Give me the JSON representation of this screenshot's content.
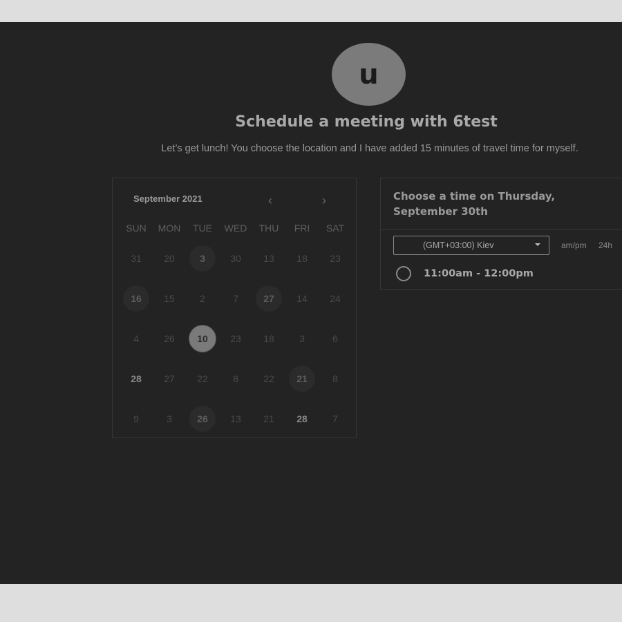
{
  "avatar": {
    "initial": "u"
  },
  "header": {
    "title": "Schedule a meeting with 6test",
    "subtitle": "Let’s get lunch! You choose the location and I have added 15 minutes of travel time for myself."
  },
  "calendar": {
    "month_label": "September 2021",
    "prev_icon": "‹",
    "next_icon": "›",
    "weekdays": [
      "SUN",
      "MON",
      "TUE",
      "WED",
      "THU",
      "FRI",
      "SAT"
    ],
    "weeks": [
      [
        {
          "d": "31"
        },
        {
          "d": "20"
        },
        {
          "d": "3",
          "avail": true
        },
        {
          "d": "30"
        },
        {
          "d": "13"
        },
        {
          "d": "18"
        },
        {
          "d": "23"
        }
      ],
      [
        {
          "d": "16",
          "avail": true
        },
        {
          "d": "15"
        },
        {
          "d": "2"
        },
        {
          "d": "7"
        },
        {
          "d": "27",
          "avail": true
        },
        {
          "d": "14"
        },
        {
          "d": "24"
        }
      ],
      [
        {
          "d": "4"
        },
        {
          "d": "26"
        },
        {
          "d": "10",
          "selected": true
        },
        {
          "d": "23"
        },
        {
          "d": "18"
        },
        {
          "d": "3"
        },
        {
          "d": "6"
        }
      ],
      [
        {
          "d": "28",
          "bold": true
        },
        {
          "d": "27"
        },
        {
          "d": "22"
        },
        {
          "d": "8"
        },
        {
          "d": "22"
        },
        {
          "d": "21",
          "avail": true
        },
        {
          "d": "8"
        }
      ],
      [
        {
          "d": "9"
        },
        {
          "d": "3"
        },
        {
          "d": "26",
          "avail": true
        },
        {
          "d": "13"
        },
        {
          "d": "21"
        },
        {
          "d": "28",
          "bold": true
        },
        {
          "d": "7"
        }
      ]
    ]
  },
  "time_panel": {
    "title": "Choose a time on Thursday, September 30th",
    "timezone": "(GMT+03:00) Kiev",
    "format_ampm": "am/pm",
    "format_24h": "24h",
    "slots": [
      "11:00am - 12:00pm"
    ]
  }
}
